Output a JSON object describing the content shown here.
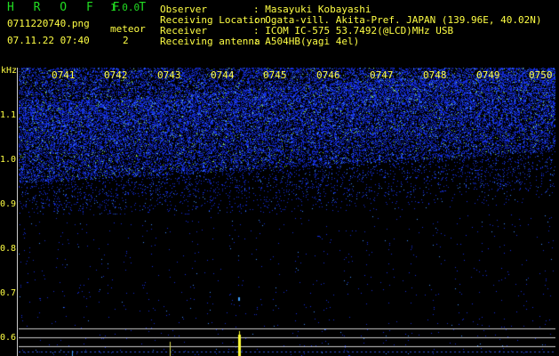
{
  "app": {
    "title": "H R O F F T",
    "version": "1.0.0"
  },
  "file": {
    "name": "0711220740.png",
    "datetime": "07.11.22 07:40"
  },
  "meteor": {
    "label": "meteor",
    "count": "2"
  },
  "info": [
    {
      "key": "Observer",
      "value": ": Masayuki Kobayashi"
    },
    {
      "key": "Receiving Location",
      "value": ": Ogata-vill. Akita-Pref. JAPAN (139.96E, 40.02N)"
    },
    {
      "key": "Receiver",
      "value": ": ICOM IC-575 53.7492(@LCD)MHz USB"
    },
    {
      "key": "Receiving antenna",
      "value": ": A504HB(yagi 4el)"
    }
  ],
  "spectrogram": {
    "y_unit": "kHz",
    "time_ticks": [
      "0741",
      "0742",
      "0743",
      "0744",
      "0745",
      "0746",
      "0747",
      "0748",
      "0749",
      "0750"
    ],
    "freq_ticks": [
      "1.1",
      "1.0",
      "0.9",
      "0.8",
      "0.7",
      "0.6"
    ],
    "freq_range_khz": [
      0.57,
      1.2
    ],
    "colors": {
      "background": "#000000",
      "noise": "#1a2fd6",
      "hot": "#ffff33",
      "text": "#ffff44",
      "title": "#22dd22"
    }
  }
}
